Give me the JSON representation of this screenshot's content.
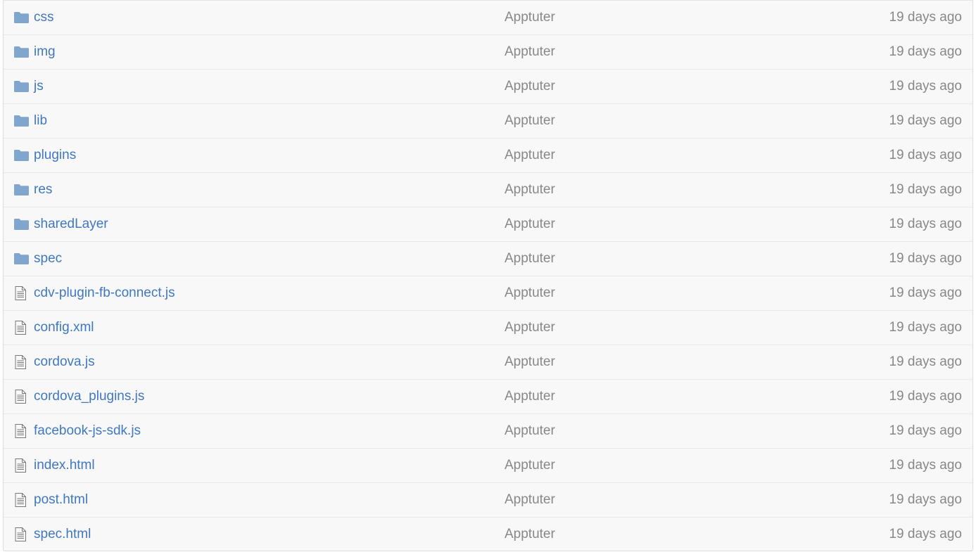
{
  "files": [
    {
      "type": "folder",
      "icon": "folder-icon",
      "name": "css",
      "author": "Apptuter",
      "age": "19 days ago"
    },
    {
      "type": "folder",
      "icon": "folder-icon",
      "name": "img",
      "author": "Apptuter",
      "age": "19 days ago"
    },
    {
      "type": "folder",
      "icon": "folder-icon",
      "name": "js",
      "author": "Apptuter",
      "age": "19 days ago"
    },
    {
      "type": "folder",
      "icon": "folder-icon",
      "name": "lib",
      "author": "Apptuter",
      "age": "19 days ago"
    },
    {
      "type": "folder",
      "icon": "folder-icon",
      "name": "plugins",
      "author": "Apptuter",
      "age": "19 days ago"
    },
    {
      "type": "folder",
      "icon": "folder-icon",
      "name": "res",
      "author": "Apptuter",
      "age": "19 days ago"
    },
    {
      "type": "folder",
      "icon": "folder-icon",
      "name": "sharedLayer",
      "author": "Apptuter",
      "age": "19 days ago"
    },
    {
      "type": "folder",
      "icon": "folder-icon",
      "name": "spec",
      "author": "Apptuter",
      "age": "19 days ago"
    },
    {
      "type": "file",
      "icon": "file-icon",
      "name": "cdv-plugin-fb-connect.js",
      "author": "Apptuter",
      "age": "19 days ago"
    },
    {
      "type": "file",
      "icon": "file-icon",
      "name": "config.xml",
      "author": "Apptuter",
      "age": "19 days ago"
    },
    {
      "type": "file",
      "icon": "file-icon",
      "name": "cordova.js",
      "author": "Apptuter",
      "age": "19 days ago"
    },
    {
      "type": "file",
      "icon": "file-icon",
      "name": "cordova_plugins.js",
      "author": "Apptuter",
      "age": "19 days ago"
    },
    {
      "type": "file",
      "icon": "file-icon",
      "name": "facebook-js-sdk.js",
      "author": "Apptuter",
      "age": "19 days ago"
    },
    {
      "type": "file",
      "icon": "file-icon",
      "name": "index.html",
      "author": "Apptuter",
      "age": "19 days ago"
    },
    {
      "type": "file",
      "icon": "file-icon",
      "name": "post.html",
      "author": "Apptuter",
      "age": "19 days ago"
    },
    {
      "type": "file",
      "icon": "file-icon",
      "name": "spec.html",
      "author": "Apptuter",
      "age": "19 days ago"
    }
  ],
  "colors": {
    "link": "#4078c0",
    "muted": "#888888",
    "folder_icon": "#80a6cd",
    "file_icon": "#777777",
    "row_bg": "#f8f8f8",
    "border": "#e5e5e5"
  }
}
